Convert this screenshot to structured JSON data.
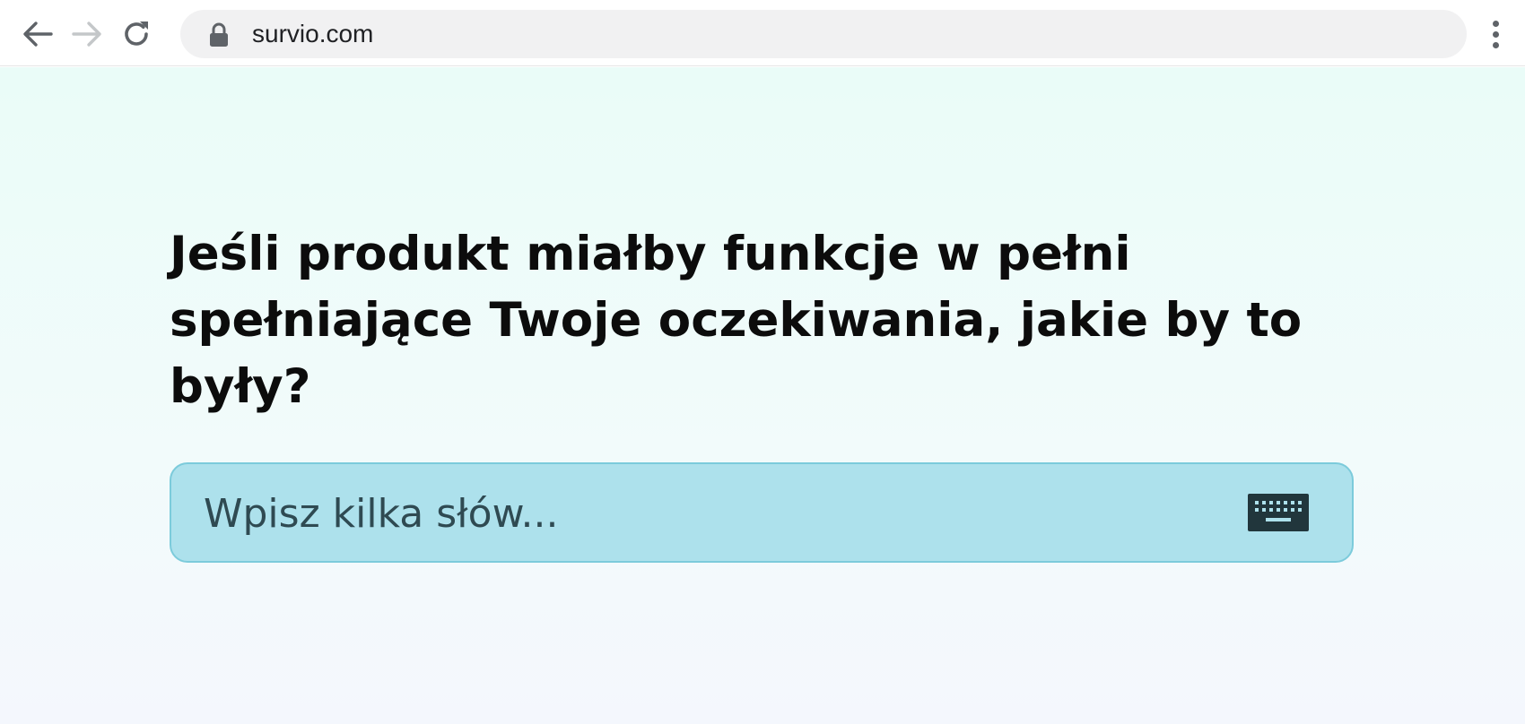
{
  "browser": {
    "url": "survio.com",
    "icons": {
      "back": "arrow-left-icon",
      "forward": "arrow-right-icon",
      "reload": "reload-icon",
      "lock": "lock-icon",
      "menu": "vertical-dots-icon"
    }
  },
  "survey": {
    "question": "Jeśli produkt miałby funkcje w pełni spełniające Twoje oczekiwania, jakie by to były?",
    "answer_placeholder": "Wpisz kilka słów...",
    "answer_value": "",
    "keyboard_icon": "keyboard-icon"
  },
  "colors": {
    "background_top": "#eafcf8",
    "input_background": "#ade1ec",
    "input_border": "#7ccbdb",
    "keyboard_icon": "#21363c",
    "question_text": "#0c0c0c"
  }
}
